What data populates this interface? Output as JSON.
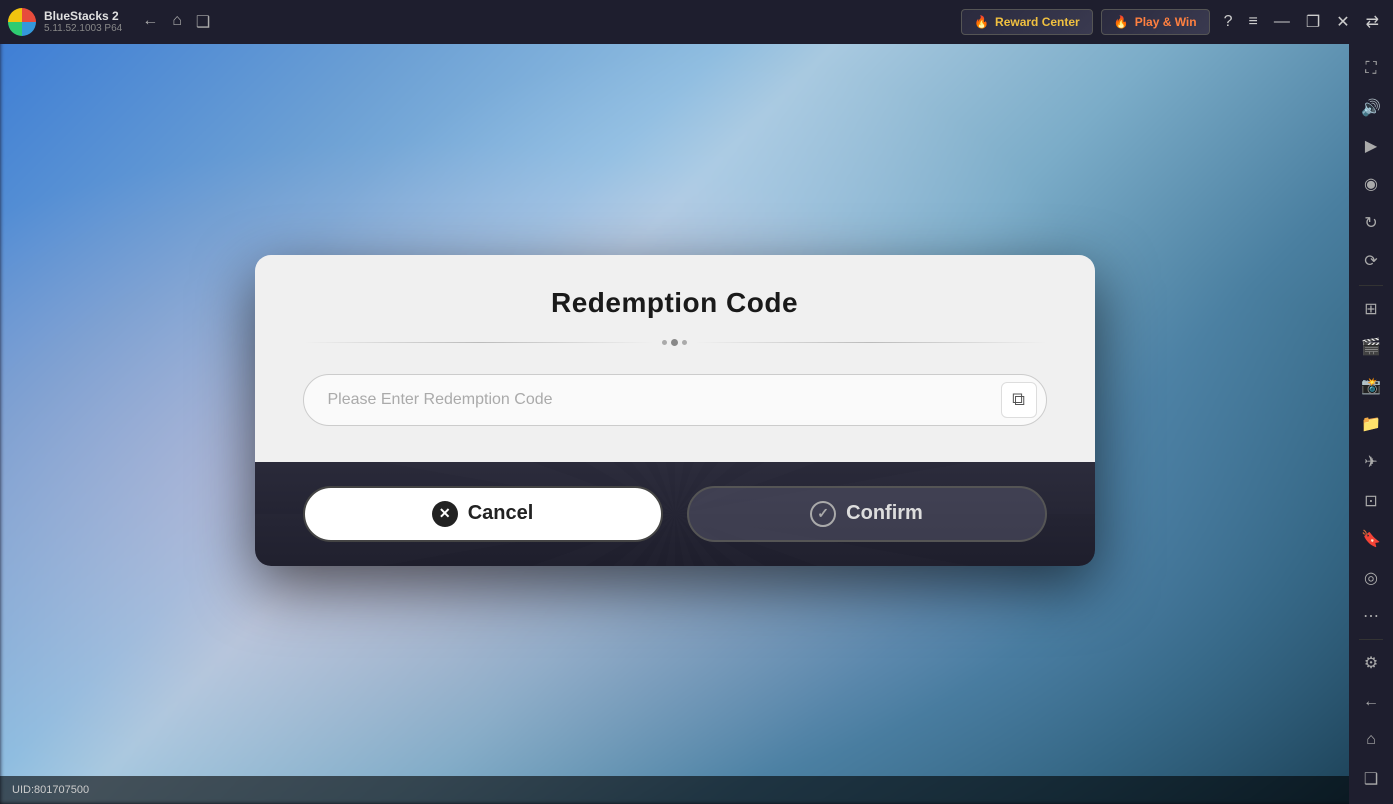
{
  "app": {
    "name": "BlueStacks 2",
    "version": "5.11.52.1003  P64",
    "logo_alt": "BlueStacks logo"
  },
  "topbar": {
    "back_label": "←",
    "home_label": "⌂",
    "multi_label": "❑",
    "reward_label": "Reward Center",
    "reward_icon": "🔥",
    "playnwin_label": "Play & Win",
    "playnwin_icon": "🔥",
    "help_icon": "?",
    "menu_icon": "≡",
    "minimize_icon": "—",
    "restore_icon": "❐",
    "close_icon": "✕",
    "expand_icon": "⇄"
  },
  "sidebar": {
    "icons": [
      {
        "name": "fullscreen-icon",
        "symbol": "⛶"
      },
      {
        "name": "volume-icon",
        "symbol": "🔊"
      },
      {
        "name": "record-icon",
        "symbol": "▶"
      },
      {
        "name": "screenshot-icon",
        "symbol": "📷"
      },
      {
        "name": "refresh-icon",
        "symbol": "↻"
      },
      {
        "name": "rotate-icon",
        "symbol": "⟳"
      },
      {
        "name": "apps-icon",
        "symbol": "⊞"
      },
      {
        "name": "media-icon",
        "symbol": "🎬"
      },
      {
        "name": "camera-icon",
        "symbol": "📸"
      },
      {
        "name": "folder-icon",
        "symbol": "📁"
      },
      {
        "name": "airplane-icon",
        "symbol": "✈"
      },
      {
        "name": "gamepad-icon",
        "symbol": "🎮"
      },
      {
        "name": "bookmark-icon",
        "symbol": "🔖"
      },
      {
        "name": "location-icon",
        "symbol": "📍"
      },
      {
        "name": "more-icon",
        "symbol": "⋯"
      },
      {
        "name": "settings-icon",
        "symbol": "⚙"
      },
      {
        "name": "back-sidebar-icon",
        "symbol": "←"
      },
      {
        "name": "home-sidebar-icon",
        "symbol": "⌂"
      },
      {
        "name": "layers-icon",
        "symbol": "❑"
      }
    ]
  },
  "dialog": {
    "title": "Redemption Code",
    "input_placeholder": "Please Enter Redemption Code",
    "paste_icon": "⧉",
    "cancel_label": "Cancel",
    "confirm_label": "Confirm"
  },
  "bottom": {
    "uid_label": "UID:801707500"
  }
}
